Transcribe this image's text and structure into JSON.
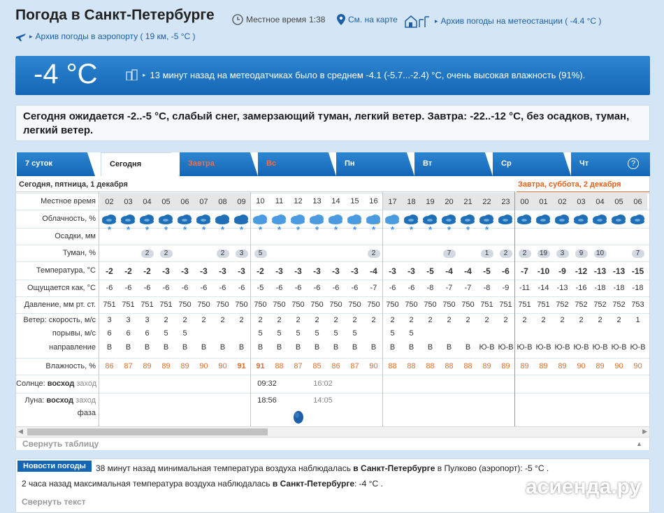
{
  "header": {
    "title": "Погода в Санкт-Петербурге",
    "local_time_label": "Местное время",
    "local_time_value": "1:38",
    "map_link": "См. на карте",
    "archive_station": "Архив погоды на метеостанции ( -4.4 °C )",
    "archive_airport": "Архив погоды в аэропорту ( 19 км, -5 °C )"
  },
  "current": {
    "temp": "-4 °C",
    "desc": "13 минут назад на метеодатчиках было в среднем -4.1 (-5.7...-2.4) °C, очень высокая влажность (91%)."
  },
  "forecast_text": "Сегодня ожидается -2..-5 °C, слабый снег, замерзающий туман, легкий ветер. Завтра: -22..-12 °C, без осадков, туман, легкий ветер.",
  "tabs": [
    "7 суток",
    "Сегодня",
    "Завтра",
    "Вс",
    "Пн",
    "Вт",
    "Ср",
    "Чт"
  ],
  "help": "?",
  "today_header": "Сегодня, пятница, 1 декабря",
  "tomorrow_header": "Завтра, суббота, 2 декабря",
  "labels": {
    "time": "Местное время",
    "cloud": "Облачность, %",
    "precip": "Осадки, мм",
    "fog": "Туман, %",
    "temp": "Температура, °C",
    "feels": "Ощущается как, °C",
    "pressure": "Давление, мм рт. ст.",
    "wind_speed": "Ветер: скорость, м/с",
    "gusts": "порывы, м/с",
    "direction": "направление",
    "humidity": "Влажность, %",
    "sun_prefix": "Солнце:",
    "rise": "восход",
    "set": "заход",
    "moon_prefix": "Луна:",
    "phase": "фаза"
  },
  "hours": [
    "02",
    "03",
    "04",
    "05",
    "06",
    "07",
    "08",
    "09",
    "10",
    "11",
    "12",
    "13",
    "14",
    "15",
    "16",
    "17",
    "18",
    "19",
    "20",
    "21",
    "22",
    "23",
    "00",
    "01",
    "02",
    "03",
    "04",
    "05",
    "06"
  ],
  "shaded_hours": [
    0,
    1,
    2,
    3,
    4,
    5,
    6,
    7,
    15,
    16,
    17,
    18,
    19,
    20,
    21,
    22,
    23,
    24,
    25,
    26,
    27,
    28
  ],
  "snow": [
    1,
    1,
    1,
    1,
    1,
    1,
    1,
    1,
    1,
    1,
    1,
    1,
    1,
    1,
    1,
    1,
    1,
    1,
    1,
    1,
    1,
    0,
    0,
    0,
    0,
    0,
    0,
    0,
    0
  ],
  "fog": [
    "",
    "",
    "2",
    "2",
    "",
    "",
    "2",
    "3",
    "5",
    "",
    "",
    "",
    "",
    "",
    "2",
    "",
    "",
    "",
    "7",
    "",
    "1",
    "2",
    "2",
    "19",
    "3",
    "9",
    "10",
    "",
    "7"
  ],
  "temperature": [
    "-2",
    "-2",
    "-2",
    "-3",
    "-3",
    "-3",
    "-3",
    "-3",
    "-2",
    "-3",
    "-3",
    "-3",
    "-3",
    "-3",
    "-4",
    "-3",
    "-3",
    "-5",
    "-4",
    "-4",
    "-5",
    "-6",
    "-7",
    "-10",
    "-9",
    "-12",
    "-13",
    "-13",
    "-15"
  ],
  "feels_like": [
    "-6",
    "-6",
    "-6",
    "-6",
    "-6",
    "-6",
    "-6",
    "-6",
    "-5",
    "-6",
    "-6",
    "-6",
    "-6",
    "-6",
    "-7",
    "-6",
    "-6",
    "-8",
    "-7",
    "-7",
    "-8",
    "-9",
    "-11",
    "-14",
    "-13",
    "-16",
    "-18",
    "-18",
    "-18"
  ],
  "pressure": [
    "751",
    "751",
    "751",
    "751",
    "750",
    "750",
    "750",
    "750",
    "750",
    "750",
    "750",
    "750",
    "750",
    "750",
    "750",
    "750",
    "750",
    "750",
    "750",
    "750",
    "751",
    "751",
    "751",
    "751",
    "752",
    "752",
    "752",
    "752",
    "753"
  ],
  "wind_speed": [
    "3",
    "3",
    "3",
    "2",
    "2",
    "2",
    "2",
    "2",
    "2",
    "2",
    "2",
    "2",
    "2",
    "2",
    "2",
    "2",
    "2",
    "2",
    "2",
    "2",
    "2",
    "2",
    "2",
    "2",
    "2",
    "2",
    "2",
    "2",
    "1"
  ],
  "gusts": [
    "6",
    "6",
    "6",
    "5",
    "5",
    "",
    "",
    "",
    "5",
    "5",
    "5",
    "5",
    "5",
    "5",
    "",
    "5",
    "5",
    "",
    "",
    "",
    "",
    "",
    "",
    "",
    "",
    "",
    "",
    "",
    ""
  ],
  "direction": [
    "В",
    "В",
    "В",
    "В",
    "В",
    "В",
    "В",
    "В",
    "В",
    "В",
    "В",
    "В",
    "В",
    "В",
    "В",
    "В",
    "В",
    "В",
    "В",
    "В",
    "Ю-В",
    "Ю-В",
    "Ю-В",
    "Ю-В",
    "Ю-В",
    "Ю-В",
    "Ю-В",
    "Ю-В",
    "Ю-В"
  ],
  "humidity": [
    "86",
    "87",
    "89",
    "89",
    "89",
    "90",
    "90",
    "91",
    "91",
    "88",
    "87",
    "85",
    "86",
    "87",
    "90",
    "88",
    "88",
    "88",
    "88",
    "88",
    "89",
    "89",
    "89",
    "89",
    "89",
    "90",
    "89",
    "90",
    "90"
  ],
  "sun": {
    "rise": "09:32",
    "set": "16:02"
  },
  "moon": {
    "rise": "18:56",
    "set": "14:05"
  },
  "collapse_table": "Свернуть таблицу",
  "news": {
    "badge": "Новости погоды",
    "n1_a": "38 минут назад минимальная температура воздуха наблюдалась",
    "n1_b": "в Санкт-Петербурге",
    "n1_c": "в Пулково (аэропорт): -5 °C .",
    "n2_a": "2 часа назад максимальная температура воздуха наблюдалась",
    "n2_b": "в Санкт-Петербурге",
    "n2_c": ": -4 °C .",
    "collapse": "Свернуть текст"
  },
  "watermark": "асиенда.ру",
  "colors": {
    "accent": "#1466b5",
    "tomorrow": "#e8601c",
    "snow": "#3a8ee6",
    "humidity": "#e07030"
  }
}
